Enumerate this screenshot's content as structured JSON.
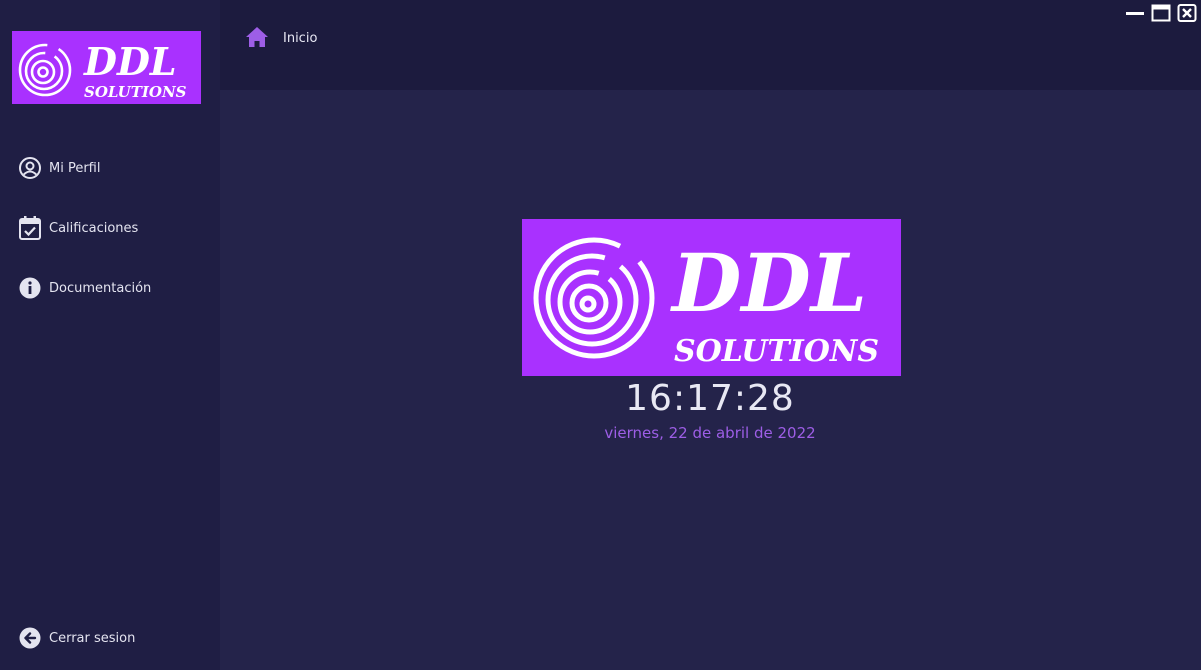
{
  "brand": {
    "line1": "DDL",
    "line2": "SOLUTIONS",
    "bg_color": "#a931ff"
  },
  "sidebar": {
    "items": [
      {
        "label": "Mi Perfil",
        "icon": "user-circle-icon"
      },
      {
        "label": "Calificaciones",
        "icon": "calendar-check-icon"
      },
      {
        "label": "Documentación",
        "icon": "info-circle-icon"
      }
    ],
    "logout": {
      "label": "Cerrar sesion",
      "icon": "arrow-left-circle-icon"
    }
  },
  "header": {
    "breadcrumb": "Inicio",
    "icon": "home-icon",
    "accent": "#9d5ee6"
  },
  "window_controls": [
    "minimize-icon",
    "maximize-icon",
    "close-icon"
  ],
  "main": {
    "time": "16:17:28",
    "date": "viernes, 22 de abril de 2022"
  }
}
